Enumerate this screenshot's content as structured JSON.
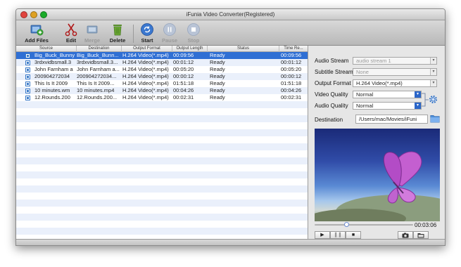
{
  "window": {
    "title": "iFunia Video Converter(Registered)"
  },
  "toolbar": {
    "add_files": "Add Files",
    "edit": "Edit",
    "merge": "Merge",
    "delete": "Delete",
    "start": "Start",
    "pause": "Pause",
    "stop": "Stop"
  },
  "table": {
    "headers": [
      "Source",
      "Destination",
      "Output Format",
      "Output Length",
      "Status",
      "Time Re..."
    ],
    "rows": [
      {
        "source": "Big_Buck_Bunny",
        "destination": "Big_Buck_Bunn...",
        "format": "H.264 Video(*.mp4)",
        "length": "00:09:56",
        "status": "Ready",
        "time": "00:09:56"
      },
      {
        "source": "3rdxvidbsmall.3",
        "destination": "3rdxvidbsmall.3...",
        "format": "H.264 Video(*.mp4)",
        "length": "00:01:12",
        "status": "Ready",
        "time": "00:01:12"
      },
      {
        "source": "John Farnham a",
        "destination": "John Farnham a...",
        "format": "H.264 Video(*.mp4)",
        "length": "00:05:20",
        "status": "Ready",
        "time": "00:05:20"
      },
      {
        "source": "200904272034",
        "destination": "200904272034...",
        "format": "H.264 Video(*.mp4)",
        "length": "00:00:12",
        "status": "Ready",
        "time": "00:00:12"
      },
      {
        "source": "This Is It 2009",
        "destination": "This Is It 2009...",
        "format": "H.264 Video(*.mp4)",
        "length": "01:51:18",
        "status": "Ready",
        "time": "01:51:18"
      },
      {
        "source": "10 minutes.wm",
        "destination": "10 minutes.mp4",
        "format": "H.264 Video(*.mp4)",
        "length": "00:04:26",
        "status": "Ready",
        "time": "00:04:26"
      },
      {
        "source": "12.Rounds.200",
        "destination": "12.Rounds.200...",
        "format": "H.264 Video(*.mp4)",
        "length": "00:02:31",
        "status": "Ready",
        "time": "00:02:31"
      }
    ]
  },
  "settings": {
    "audio_stream_label": "Audio Stream",
    "audio_stream_value": "audio stream 1",
    "subtitle_stream_label": "Subtitle Stream",
    "subtitle_stream_value": "None",
    "output_format_label": "Output Format",
    "output_format_value": "H.264 Video(*.mp4)",
    "video_quality_label": "Video Quality",
    "video_quality_value": "Normal",
    "audio_quality_label": "Audio Quality",
    "audio_quality_value": "Normal",
    "destination_label": "Destination",
    "destination_value": "/Users/mac/Movies/iFuni"
  },
  "player": {
    "duration": "00:03:06",
    "progress": 0.3
  },
  "colors": {
    "selection": "#2f6fd4",
    "accent": "#2b66c9"
  },
  "icons": {
    "add_files": "film-plus-icon",
    "edit": "scissors-icon",
    "merge": "merge-film-icon",
    "delete": "trash-icon",
    "start": "refresh-circle-icon",
    "pause": "pause-circle-icon",
    "stop": "stop-circle-icon",
    "settings": "gear-icon",
    "folder": "folder-icon",
    "snapshot": "camera-icon",
    "open_folder": "open-folder-icon"
  }
}
